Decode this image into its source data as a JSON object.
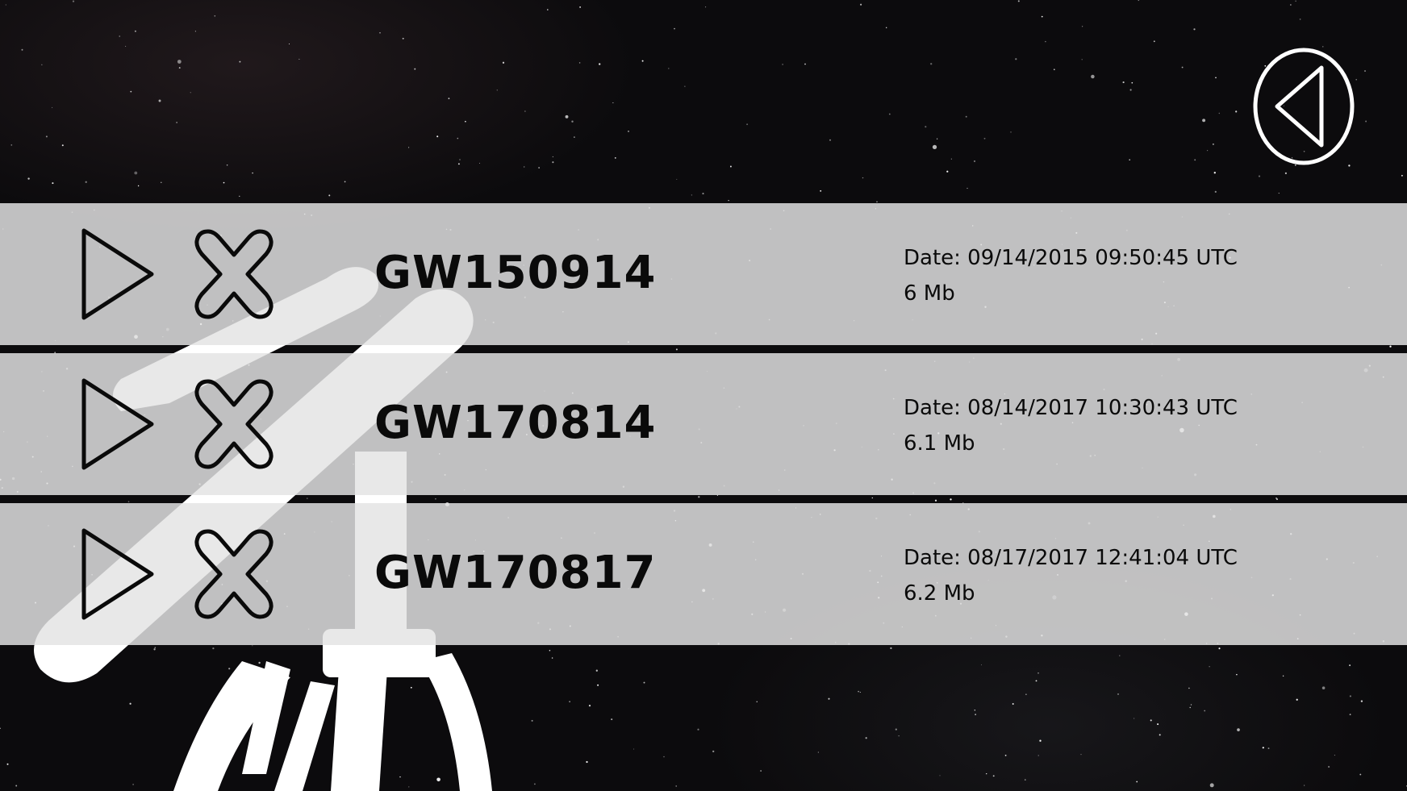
{
  "screen": {
    "background": "starfield",
    "accent_color": "#ffffff",
    "row_color": "#e4e4e4",
    "text_color": "#0a0a0a"
  },
  "navigation": {
    "back_icon": "back-triangle-circle-icon"
  },
  "events": [
    {
      "name": "GW150914",
      "date": "Date: 09/14/2015 09:50:45 UTC",
      "size": "6 Mb"
    },
    {
      "name": "GW170814",
      "date": "Date: 08/14/2017 10:30:43 UTC",
      "size": "6.1 Mb"
    },
    {
      "name": "GW170817",
      "date": "Date: 08/17/2017 12:41:04 UTC",
      "size": "6.2 Mb"
    }
  ],
  "row_icons": {
    "play": "play-icon",
    "delete": "close-x-icon"
  },
  "decoration": {
    "silhouette": "telescope-icon"
  }
}
